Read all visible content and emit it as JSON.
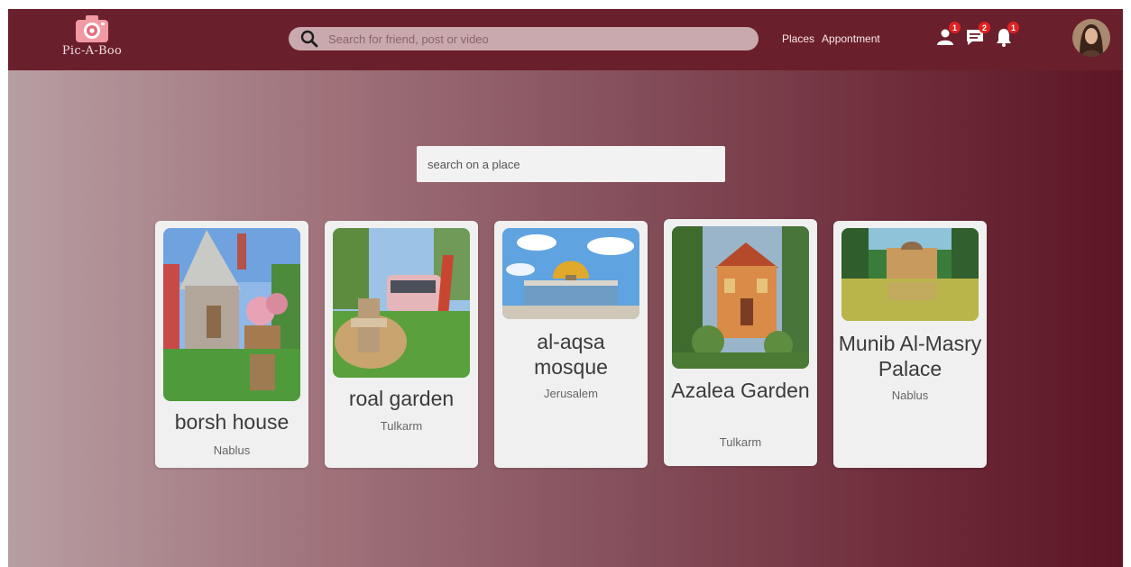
{
  "app": {
    "brand_name": "Pic-A-Boo"
  },
  "header": {
    "search_placeholder": "Search for friend, post or video",
    "nav": {
      "places": "Places",
      "appointment": "Appontment"
    },
    "badges": {
      "friends": "1",
      "messages": "2",
      "notifications": "1"
    }
  },
  "place_search": {
    "placeholder": "search on a place"
  },
  "places": [
    {
      "name": "borsh house",
      "city": "Nablus"
    },
    {
      "name": "roal garden",
      "city": "Tulkarm"
    },
    {
      "name": "al-aqsa mosque",
      "city": "Jerusalem"
    },
    {
      "name": "Azalea Garden",
      "city": "Tulkarm"
    },
    {
      "name": "Munib Al-Masry Palace",
      "city": "Nablus"
    }
  ],
  "colors": {
    "header_bg": "#6a1f2c",
    "badge": "#e02222",
    "card_bg": "#f1f0f0"
  }
}
